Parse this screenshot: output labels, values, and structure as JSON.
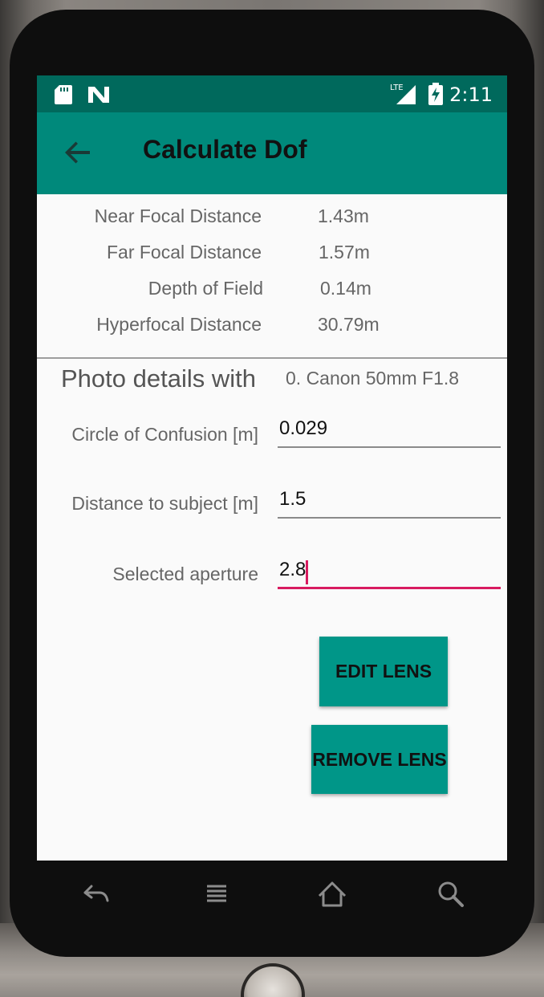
{
  "status_bar": {
    "time": "2:11",
    "network": "LTE",
    "icons": [
      "sd-card-icon",
      "n-notification-icon",
      "lte-signal-icon",
      "battery-charging-icon"
    ]
  },
  "app_bar": {
    "title": "Calculate Dof",
    "back_icon": "back-arrow-icon"
  },
  "results": [
    {
      "label": "Near Focal Distance",
      "value": "1.43m"
    },
    {
      "label": "Far Focal Distance",
      "value": "1.57m"
    },
    {
      "label": "Depth of Field",
      "value": "0.14m"
    },
    {
      "label": "Hyperfocal Distance",
      "value": "30.79m"
    }
  ],
  "photo_details": {
    "title": "Photo details with",
    "lens_name": "0. Canon 50mm F1.8"
  },
  "fields": {
    "coc": {
      "label": "Circle of Confusion [m]",
      "value": "0.029"
    },
    "distance": {
      "label": "Distance to subject [m]",
      "value": "1.5"
    },
    "aperture": {
      "label": "Selected aperture",
      "value": "2.8"
    }
  },
  "buttons": {
    "edit": "EDIT LENS",
    "remove": "REMOVE LENS"
  },
  "colors": {
    "status_bar": "#00695c",
    "app_bar": "#00897b",
    "button": "#009688",
    "accent": "#d81b60"
  },
  "nav_bar": {
    "icons": [
      "back-icon",
      "menu-icon",
      "home-icon",
      "search-icon"
    ]
  }
}
